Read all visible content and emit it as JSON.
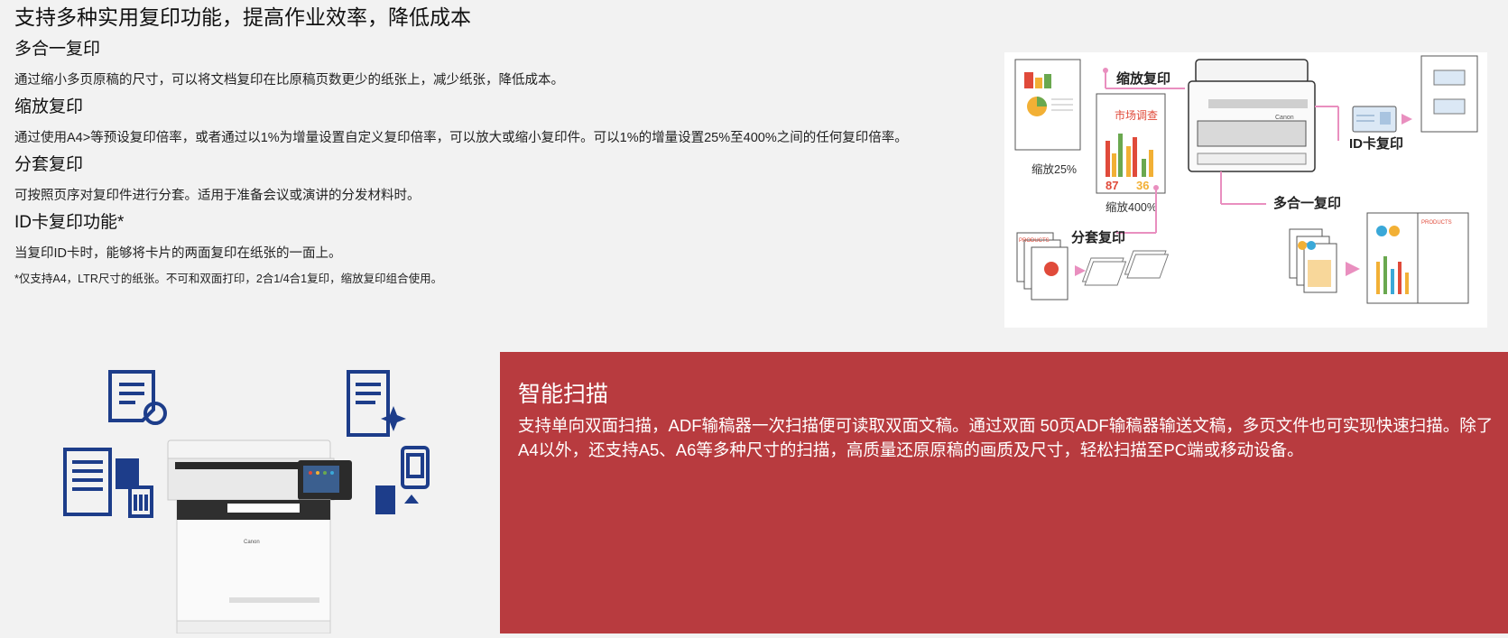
{
  "copy_section": {
    "title": "支持多种实用复印功能，提高作业效率，降低成本",
    "features": [
      {
        "heading": "多合一复印",
        "desc": "通过缩小多页原稿的尺寸，可以将文档复印在比原稿页数更少的纸张上，减少纸张，降低成本。"
      },
      {
        "heading": "缩放复印",
        "desc": "通过使用A4>等预设复印倍率，或者通过以1%为增量设置自定义复印倍率，可以放大或缩小复印件。可以1%的增量设置25%至400%之间的任何复印倍率。"
      },
      {
        "heading": "分套复印",
        "desc": "可按照页序对复印件进行分套。适用于准备会议或演讲的分发材料时。"
      },
      {
        "heading": "ID卡复印功能*",
        "desc": "当复印ID卡时，能够将卡片的两面复印在纸张的一面上。"
      }
    ],
    "note": "*仅支持A4，LTR尺寸的纸张。不可和双面打印，2合1/4合1复印，缩放复印组合使用。"
  },
  "diagram": {
    "label_zoom": "缩放复印",
    "label_zoom25": "缩放25%",
    "label_zoom400": "缩放400%",
    "label_market": "市场调查",
    "label_87": "87",
    "label_36": "36",
    "label_id": "ID卡复印",
    "label_nup": "多合一复印",
    "label_collate": "分套复印",
    "label_products": "PRODUCTS",
    "label_products2": "PRODUCTS",
    "label_brand": "Canon",
    "pink": "#e98fbf"
  },
  "printer": {
    "brand": "Canon"
  },
  "scan_section": {
    "title": "智能扫描",
    "desc": "支持单向双面扫描，ADF输稿器一次扫描便可读取双面文稿。通过双面 50页ADF输稿器输送文稿，多页文件也可实现快速扫描。除了A4以外，还支持A5、A6等多种尺寸的扫描，高质量还原原稿的画质及尺寸，轻松扫描至PC端或移动设备。",
    "bg_color": "#b83b3f"
  }
}
